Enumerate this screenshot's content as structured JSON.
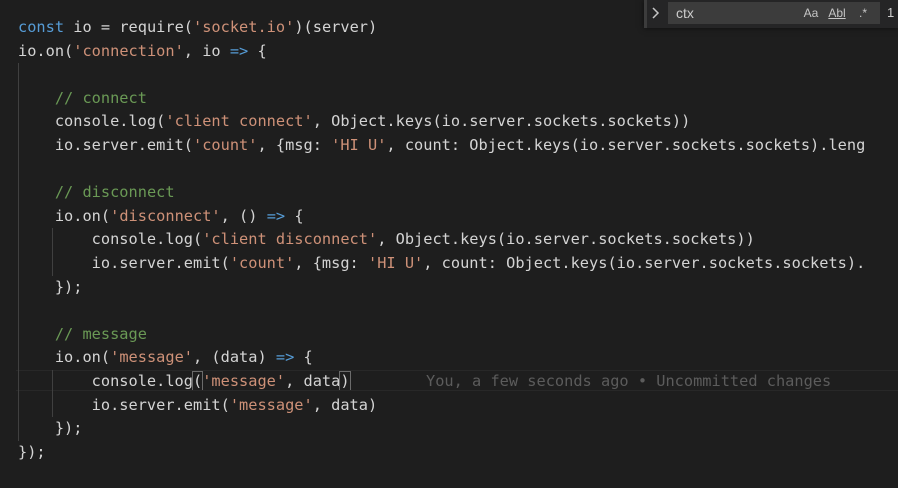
{
  "find_widget": {
    "query": "ctx",
    "match_case_label": "Aa",
    "whole_word_label": "Abl",
    "regex_label": ".*",
    "match_count": "1"
  },
  "code_lines": [
    [
      {
        "t": "const",
        "c": "kw"
      },
      {
        "t": " io = require("
      },
      {
        "t": "'socket.io'",
        "c": "str"
      },
      {
        "t": ")(server)"
      }
    ],
    [
      {
        "t": "io.on("
      },
      {
        "t": "'connection'",
        "c": "str"
      },
      {
        "t": ", io "
      },
      {
        "t": "=>",
        "c": "kw"
      },
      {
        "t": " {"
      }
    ],
    [],
    [
      {
        "t": "    "
      },
      {
        "t": "// connect",
        "c": "com"
      }
    ],
    [
      {
        "t": "    console.log("
      },
      {
        "t": "'client connect'",
        "c": "str"
      },
      {
        "t": ", Object.keys(io.server.sockets.sockets))"
      }
    ],
    [
      {
        "t": "    io.server.emit("
      },
      {
        "t": "'count'",
        "c": "str"
      },
      {
        "t": ", {msg: "
      },
      {
        "t": "'HI U'",
        "c": "str"
      },
      {
        "t": ", count: Object.keys(io.server.sockets.sockets).leng"
      }
    ],
    [],
    [
      {
        "t": "    "
      },
      {
        "t": "// disconnect",
        "c": "com"
      }
    ],
    [
      {
        "t": "    io.on("
      },
      {
        "t": "'disconnect'",
        "c": "str"
      },
      {
        "t": ", () "
      },
      {
        "t": "=>",
        "c": "kw"
      },
      {
        "t": " {"
      }
    ],
    [
      {
        "t": "        console.log("
      },
      {
        "t": "'client disconnect'",
        "c": "str"
      },
      {
        "t": ", Object.keys(io.server.sockets.sockets))"
      }
    ],
    [
      {
        "t": "        io.server.emit("
      },
      {
        "t": "'count'",
        "c": "str"
      },
      {
        "t": ", {msg: "
      },
      {
        "t": "'HI U'",
        "c": "str"
      },
      {
        "t": ", count: Object.keys(io.server.sockets.sockets)."
      }
    ],
    [
      {
        "t": "    });"
      }
    ],
    [],
    [
      {
        "t": "    "
      },
      {
        "t": "// message",
        "c": "com"
      }
    ],
    [
      {
        "t": "    io.on("
      },
      {
        "t": "'message'",
        "c": "str"
      },
      {
        "t": ", (data) "
      },
      {
        "t": "=>",
        "c": "kw"
      },
      {
        "t": " {"
      }
    ],
    [
      {
        "t": "        console.log"
      },
      {
        "t": "(",
        "m": true
      },
      {
        "t": "'message'",
        "c": "str"
      },
      {
        "t": ", data"
      },
      {
        "t": ")",
        "m": true
      }
    ],
    [
      {
        "t": "        io.server.emit("
      },
      {
        "t": "'message'",
        "c": "str"
      },
      {
        "t": ", data)"
      }
    ],
    [
      {
        "t": "    });"
      }
    ],
    [
      {
        "t": "});"
      }
    ]
  ],
  "current_line": 15,
  "blame_annotation": "You, a few seconds ago • Uncommitted changes",
  "colors": {
    "background": "#1e1e1e",
    "text": "#d4d4d4",
    "keyword": "#569cd6",
    "string": "#ce9178",
    "comment": "#6a9955",
    "blame": "#5c5c5c"
  }
}
